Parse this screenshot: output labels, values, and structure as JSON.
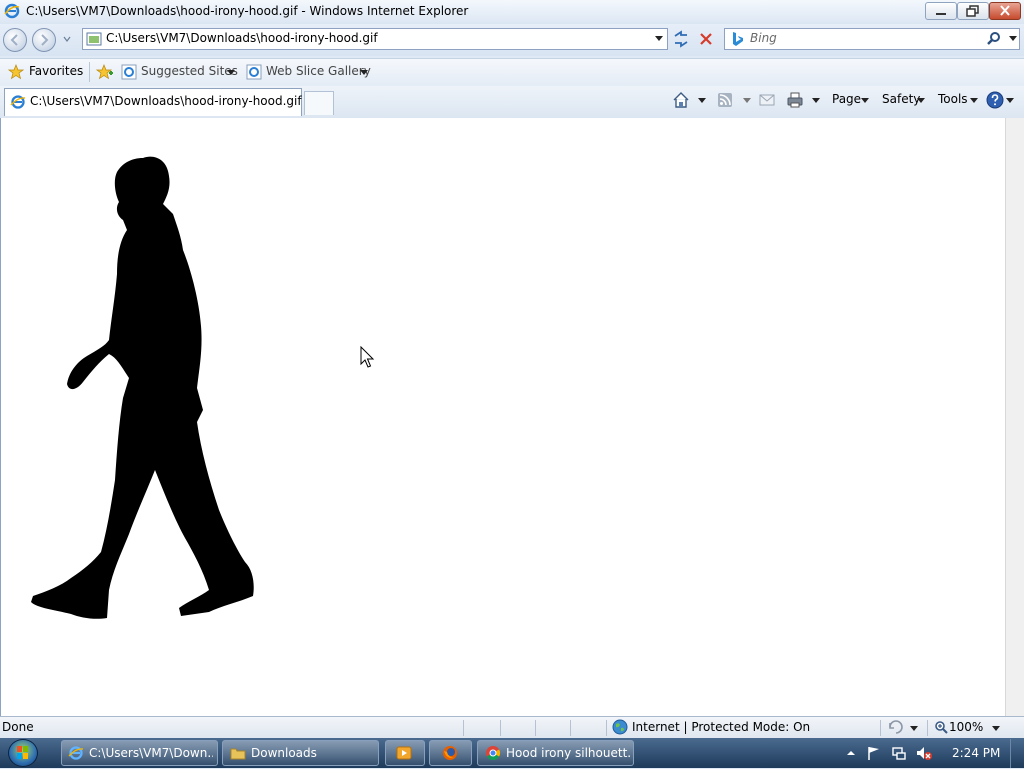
{
  "window": {
    "title": "C:\\Users\\VM7\\Downloads\\hood-irony-hood.gif - Windows Internet Explorer"
  },
  "address_bar": {
    "url": "C:\\Users\\VM7\\Downloads\\hood-irony-hood.gif"
  },
  "search": {
    "placeholder": "Bing"
  },
  "favorites_bar": {
    "favorites_label": "Favorites",
    "items": [
      {
        "label": "Suggested Sites"
      },
      {
        "label": "Web Slice Gallery"
      }
    ]
  },
  "tab": {
    "label": "C:\\Users\\VM7\\Downloads\\hood-irony-hood.gif"
  },
  "command_bar": {
    "page": "Page",
    "safety": "Safety",
    "tools": "Tools"
  },
  "status_bar": {
    "status": "Done",
    "zone": "Internet | Protected Mode: On",
    "zoom": "100%"
  },
  "taskbar": {
    "items": [
      {
        "label": "C:\\Users\\VM7\\Down..."
      },
      {
        "label": "Downloads"
      },
      {
        "label": "Hood irony silhouett..."
      }
    ],
    "clock": "2:24 PM"
  },
  "colors": {
    "accent": "#1e3a5b",
    "chrome": "#dfe9f5",
    "close_button": "#c74b2e"
  }
}
